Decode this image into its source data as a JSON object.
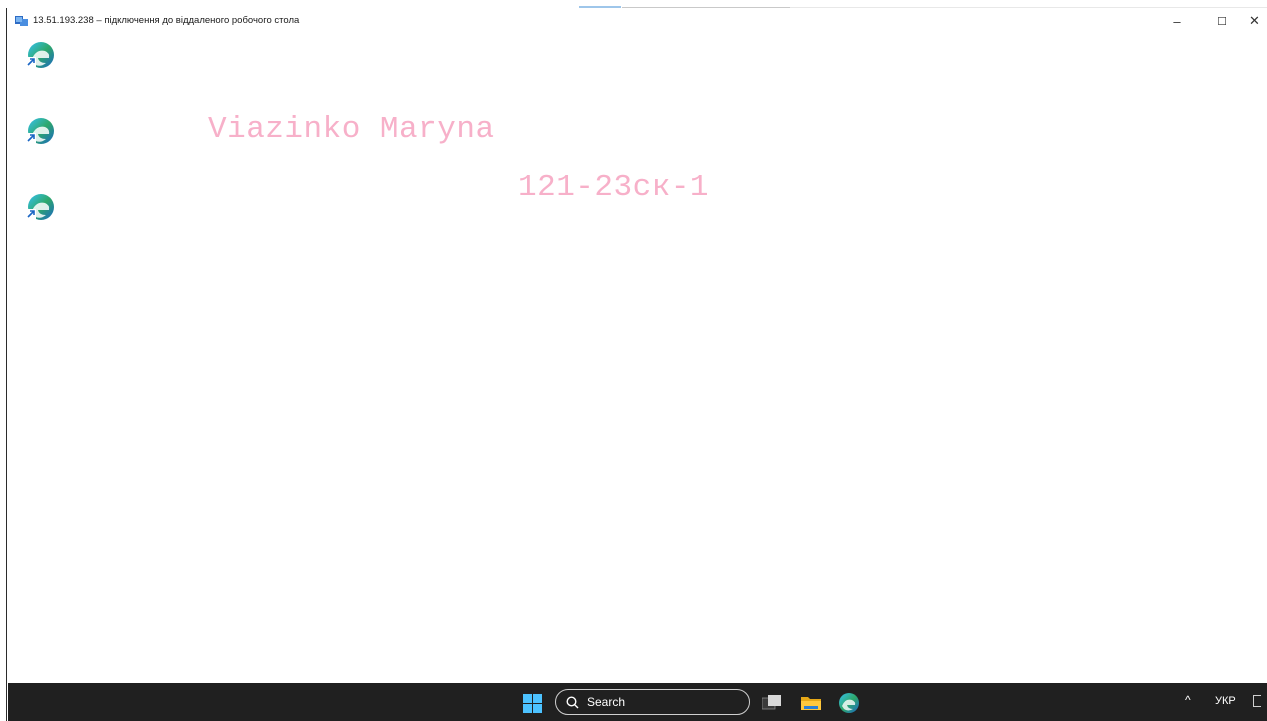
{
  "window": {
    "title": "13.51.193.238 – підключення до віддаленого робочого стола",
    "minimize": "–",
    "maximize": "☐",
    "close": "✕"
  },
  "desktop": {
    "icons": [
      {
        "name": "edge-shortcut-1",
        "icon": "edge-icon"
      },
      {
        "name": "edge-shortcut-2",
        "icon": "edge-icon"
      },
      {
        "name": "edge-shortcut-3",
        "icon": "edge-icon"
      }
    ],
    "watermark": {
      "name": "Viazinko Maryna",
      "group": "121-23ск-1",
      "color": "#f7b0c9"
    }
  },
  "taskbar": {
    "search_label": "Search",
    "tray_arrow": "^",
    "language": "УКР",
    "icons": [
      "windows-start-icon",
      "search-icon",
      "task-view-icon",
      "file-explorer-icon",
      "edge-icon"
    ]
  }
}
